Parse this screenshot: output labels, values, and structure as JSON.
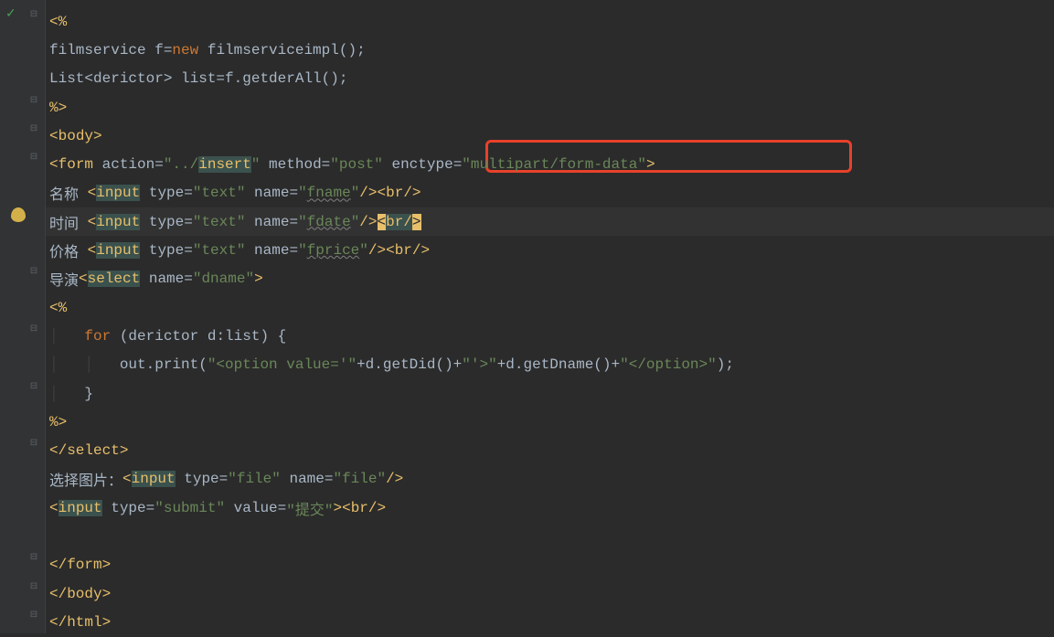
{
  "gutter": {
    "foldMinus": "⊟",
    "foldPlus": "⊞",
    "check": "✓"
  },
  "lines": {
    "l1": {
      "open": "<%"
    },
    "l2": {
      "text": "filmservice f=",
      "kw": "new",
      " text2": " filmserviceimpl();"
    },
    "l3": {
      "text": "List<derictor> list=f.getderAll();"
    },
    "l4": {
      "close": "%>"
    },
    "l5": {
      "tag": "body"
    },
    "l6": {
      "tag": "form",
      "attr1": " action=",
      "val1": "\"../",
      "insert": "insert",
      "val1b": "\"",
      "attr2": " method=",
      "val2": "\"post\"",
      "attr3": " enctype=",
      "val3": "\"multipart/form-data\"",
      ">": ">"
    },
    "l7": {
      "label": "名称 ",
      "tag": "input",
      "attr1": " type=",
      "val1": "\"text\"",
      "attr2": " name=",
      "val2": "\"",
      "wavy": "fname",
      "val2b": "\"",
      "close": "/>",
      "brtag": "br",
      "brclose": "/>"
    },
    "l8": {
      "label": "时间 ",
      "tag": "input",
      "attr1": " type=",
      "val1": "\"text\"",
      "attr2": " name=",
      "val2": "\"",
      "wavy": "fdate",
      "val2b": "\"",
      "close": "/>",
      "brtag": "br",
      "brclose": "/>",
      "highlight": true
    },
    "l9": {
      "label": "价格 ",
      "tag": "input",
      "attr1": " type=",
      "val1": "\"text\"",
      "attr2": " name=",
      "val2": "\"",
      "wavy": "fprice",
      "val2b": "\"",
      "close": "/>",
      "brtag": "br",
      "brclose": "/>"
    },
    "l10": {
      "label": "导演",
      "sel": "select",
      "attr": " name=",
      "val": "\"dname\"",
      ">": ">"
    },
    "l11": {
      "open": "<%"
    },
    "l12": {
      "kw": "for",
      "text": " (derictor d:list) {"
    },
    "l13": {
      "text": "out.print(",
      "str": "\"<option value='\"",
      "text2": "+d.getDid()+",
      "str2": "\"'>\"",
      "text3": "+d.getDname()+",
      "str3": "\"</option>\"",
      "text4": ");"
    },
    "l14": {
      "text": "}"
    },
    "l15": {
      "close": "%>"
    },
    "l16": {
      "ctag": "select"
    },
    "l17": {
      "label": "选择图片：",
      "tag": "input",
      "attr1": " type=",
      "val1": "\"file\"",
      "attr2": " name=",
      "val2": "\"file\"",
      "close": "/>"
    },
    "l18": {
      "tag": "input",
      "attr1": " type=",
      "val1": "\"submit\"",
      "attr2": " value=",
      "val2": "\"提交\"",
      ">": ">",
      "brtag": "br",
      "brclose": "/>"
    },
    "l19": {
      "empty": true
    },
    "l20": {
      "ctag": "form"
    },
    "l21": {
      "ctag": "body"
    },
    "l22": {
      "ctag": "html"
    }
  }
}
